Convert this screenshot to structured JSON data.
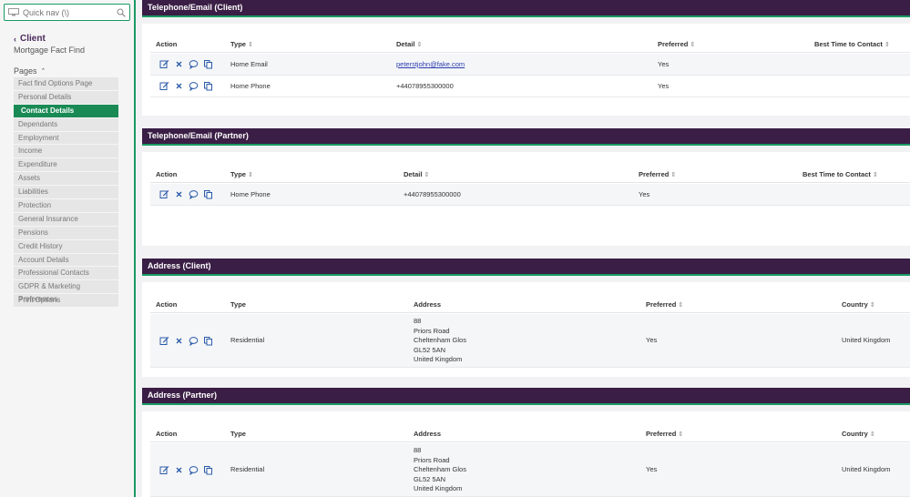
{
  "sidebar": {
    "quicknav_placeholder": "Quick nav (\\)",
    "client_label": "Client",
    "subtitle": "Mortgage Fact Find",
    "pages_label": "Pages",
    "items": [
      {
        "label": "Fact find Options Page"
      },
      {
        "label": "Personal Details"
      },
      {
        "label": "Contact Details"
      },
      {
        "label": "Dependants"
      },
      {
        "label": "Employment"
      },
      {
        "label": "Income"
      },
      {
        "label": "Expenditure"
      },
      {
        "label": "Assets"
      },
      {
        "label": "Liabilities"
      },
      {
        "label": "Protection"
      },
      {
        "label": "General Insurance"
      },
      {
        "label": "Pensions"
      },
      {
        "label": "Credit History"
      },
      {
        "label": "Account Details"
      },
      {
        "label": "Professional Contacts"
      },
      {
        "label": "GDPR & Marketing Preferences"
      },
      {
        "label": "Print Options"
      }
    ],
    "active_item": "Contact Details"
  },
  "sections": {
    "tel_client": {
      "title": "Telephone/Email (Client)",
      "headers": {
        "action": "Action",
        "type": "Type",
        "detail": "Detail",
        "preferred": "Preferred",
        "best_time": "Best Time to Contact"
      },
      "rows": [
        {
          "type": "Home Email",
          "detail": "peterstjohn@fake.com",
          "preferred": "Yes"
        },
        {
          "type": "Home Phone",
          "detail": "+44078955300000",
          "preferred": "Yes"
        }
      ]
    },
    "tel_partner": {
      "title": "Telephone/Email (Partner)",
      "headers": {
        "action": "Action",
        "type": "Type",
        "detail": "Detail",
        "preferred": "Preferred",
        "best_time": "Best Time to Contact"
      },
      "rows": [
        {
          "type": "Home Phone",
          "detail": "+44078955300000",
          "preferred": "Yes"
        }
      ]
    },
    "addr_client": {
      "title": "Address (Client)",
      "headers": {
        "action": "Action",
        "type": "Type",
        "address": "Address",
        "preferred": "Preferred",
        "country": "Country"
      },
      "rows": [
        {
          "type": "Residential",
          "address": [
            "88",
            "Priors Road",
            "Cheltenham Glos",
            "GL52 5AN",
            "United Kingdom"
          ],
          "preferred": "Yes",
          "country": "United Kingdom"
        }
      ]
    },
    "addr_partner": {
      "title": "Address (Partner)",
      "headers": {
        "action": "Action",
        "type": "Type",
        "address": "Address",
        "preferred": "Preferred",
        "country": "Country"
      },
      "rows": [
        {
          "type": "Residential",
          "address": [
            "88",
            "Priors Road",
            "Cheltenham Glos",
            "GL52 5AN",
            "United Kingdom"
          ],
          "preferred": "Yes",
          "country": "United Kingdom"
        }
      ]
    }
  },
  "icons": {
    "edit": "edit-icon",
    "delete": "close-icon",
    "comment": "comment-icon",
    "copy": "copy-icon",
    "sort": "sort-icon",
    "search": "search-icon",
    "monitor": "monitor-icon"
  },
  "colors": {
    "header_bg": "#3a1e45",
    "accent_green": "#1a9a63",
    "active_nav": "#1a8a55",
    "icon_blue": "#2a5aa8"
  }
}
